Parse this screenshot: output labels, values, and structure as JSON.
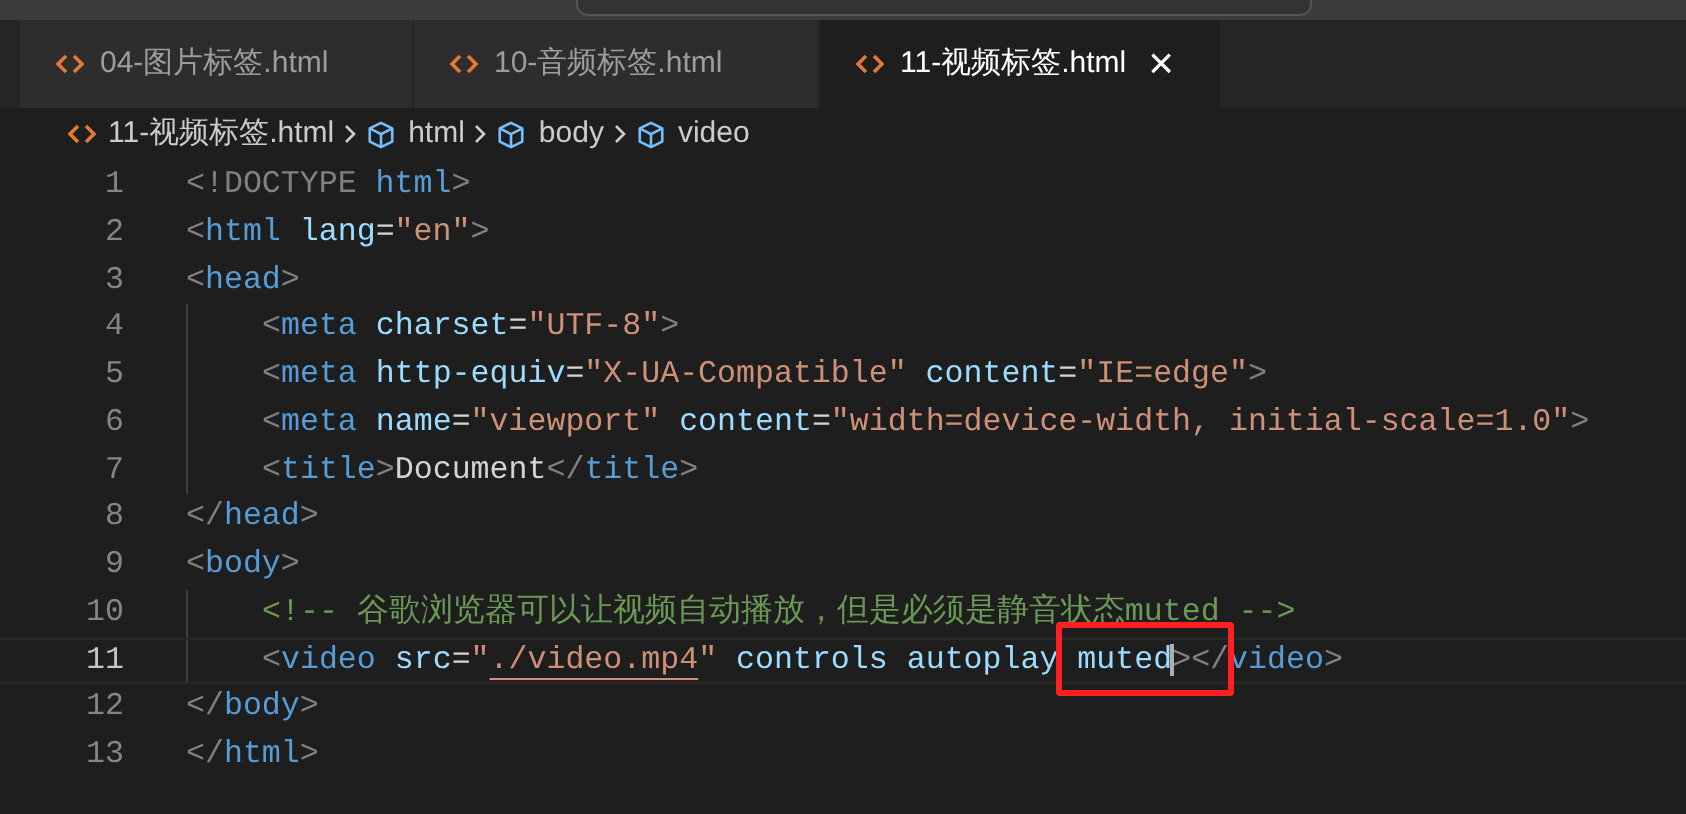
{
  "tabs": [
    {
      "label": "04-图片标签.html",
      "selected": false
    },
    {
      "label": "10-音频标签.html",
      "selected": false
    },
    {
      "label": "11-视频标签.html",
      "selected": true,
      "close": "×"
    }
  ],
  "breadcrumb": [
    {
      "label": "11-视频标签.html",
      "kind": "file"
    },
    {
      "label": "html",
      "kind": "element"
    },
    {
      "label": "body",
      "kind": "element"
    },
    {
      "label": "video",
      "kind": "element"
    }
  ],
  "lines": [
    {
      "number": "1",
      "current": false,
      "indented": false,
      "tokens": [
        {
          "kind": "punct",
          "text": "<!DOCTYPE"
        },
        {
          "kind": "tag",
          "text": " html"
        },
        {
          "kind": "punct",
          "text": ">"
        }
      ]
    },
    {
      "number": "2",
      "current": false,
      "indented": false,
      "tokens": [
        {
          "kind": "punct",
          "text": "<"
        },
        {
          "kind": "tag",
          "text": "html"
        },
        {
          "kind": "attr",
          "text": " lang"
        },
        {
          "kind": "text",
          "text": "="
        },
        {
          "kind": "string",
          "text": "\"en\""
        },
        {
          "kind": "punct",
          "text": ">"
        }
      ]
    },
    {
      "number": "3",
      "current": false,
      "indented": false,
      "tokens": [
        {
          "kind": "punct",
          "text": "<"
        },
        {
          "kind": "tag",
          "text": "head"
        },
        {
          "kind": "punct",
          "text": ">"
        }
      ]
    },
    {
      "number": "4",
      "current": false,
      "indented": true,
      "tokens": [
        {
          "kind": "punct",
          "text": "<"
        },
        {
          "kind": "tag",
          "text": "meta"
        },
        {
          "kind": "attr",
          "text": " charset"
        },
        {
          "kind": "text",
          "text": "="
        },
        {
          "kind": "string",
          "text": "\"UTF-8\""
        },
        {
          "kind": "punct",
          "text": ">"
        }
      ]
    },
    {
      "number": "5",
      "current": false,
      "indented": true,
      "tokens": [
        {
          "kind": "punct",
          "text": "<"
        },
        {
          "kind": "tag",
          "text": "meta"
        },
        {
          "kind": "attr",
          "text": " http-equiv"
        },
        {
          "kind": "text",
          "text": "="
        },
        {
          "kind": "string",
          "text": "\"X-UA-Compatible\""
        },
        {
          "kind": "attr",
          "text": " content"
        },
        {
          "kind": "text",
          "text": "="
        },
        {
          "kind": "string",
          "text": "\"IE=edge\""
        },
        {
          "kind": "punct",
          "text": ">"
        }
      ]
    },
    {
      "number": "6",
      "current": false,
      "indented": true,
      "tokens": [
        {
          "kind": "punct",
          "text": "<"
        },
        {
          "kind": "tag",
          "text": "meta"
        },
        {
          "kind": "attr",
          "text": " name"
        },
        {
          "kind": "text",
          "text": "="
        },
        {
          "kind": "string",
          "text": "\"viewport\""
        },
        {
          "kind": "attr",
          "text": " content"
        },
        {
          "kind": "text",
          "text": "="
        },
        {
          "kind": "string",
          "text": "\"width=device-width, initial-scale=1.0\""
        },
        {
          "kind": "punct",
          "text": ">"
        }
      ]
    },
    {
      "number": "7",
      "current": false,
      "indented": true,
      "tokens": [
        {
          "kind": "punct",
          "text": "<"
        },
        {
          "kind": "tag",
          "text": "title"
        },
        {
          "kind": "punct",
          "text": ">"
        },
        {
          "kind": "text",
          "text": "Document"
        },
        {
          "kind": "punct",
          "text": "</"
        },
        {
          "kind": "tag",
          "text": "title"
        },
        {
          "kind": "punct",
          "text": ">"
        }
      ]
    },
    {
      "number": "8",
      "current": false,
      "indented": false,
      "tokens": [
        {
          "kind": "punct",
          "text": "</"
        },
        {
          "kind": "tag",
          "text": "head"
        },
        {
          "kind": "punct",
          "text": ">"
        }
      ]
    },
    {
      "number": "9",
      "current": false,
      "indented": false,
      "tokens": [
        {
          "kind": "punct",
          "text": "<"
        },
        {
          "kind": "tag",
          "text": "body"
        },
        {
          "kind": "punct",
          "text": ">"
        }
      ]
    },
    {
      "number": "10",
      "current": false,
      "indented": true,
      "tokens": [
        {
          "kind": "comment",
          "text": "<!-- 谷歌浏览器可以让视频自动播放，但是必须是静音状态muted -->"
        }
      ]
    },
    {
      "number": "11",
      "current": true,
      "indented": true,
      "tokens": [
        {
          "kind": "punct",
          "text": "<"
        },
        {
          "kind": "tag",
          "text": "video"
        },
        {
          "kind": "attr",
          "text": " src"
        },
        {
          "kind": "text",
          "text": "="
        },
        {
          "kind": "string",
          "text": "\""
        },
        {
          "kind": "string",
          "text": "./video.mp4",
          "link": true
        },
        {
          "kind": "string",
          "text": "\""
        },
        {
          "kind": "attr",
          "text": " controls"
        },
        {
          "kind": "attr",
          "text": " autoplay"
        },
        {
          "kind": "attr",
          "text": " muted",
          "highlighted": true,
          "cursor": true
        },
        {
          "kind": "punct",
          "text": "></"
        },
        {
          "kind": "tag",
          "text": "video"
        },
        {
          "kind": "punct",
          "text": ">"
        }
      ]
    },
    {
      "number": "12",
      "current": false,
      "indented": false,
      "tokens": [
        {
          "kind": "punct",
          "text": "</"
        },
        {
          "kind": "tag",
          "text": "body"
        },
        {
          "kind": "punct",
          "text": ">"
        }
      ]
    },
    {
      "number": "13",
      "current": false,
      "indented": false,
      "tokens": [
        {
          "kind": "punct",
          "text": "</"
        },
        {
          "kind": "tag",
          "text": "html"
        },
        {
          "kind": "punct",
          "text": ">"
        }
      ]
    }
  ]
}
